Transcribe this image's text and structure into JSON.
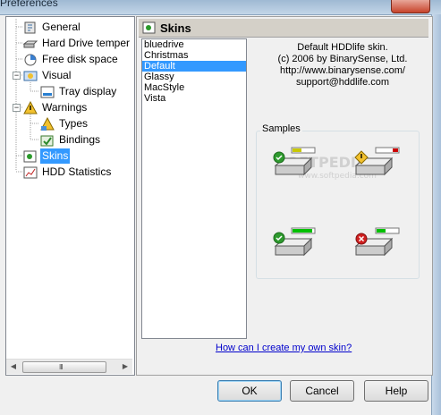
{
  "window": {
    "title": "Preferences"
  },
  "tree": {
    "items": [
      {
        "label": "General",
        "icon": "general-settings-icon",
        "selected": false
      },
      {
        "label": "Hard Drive temper",
        "icon": "hard-drive-icon",
        "selected": false
      },
      {
        "label": "Free disk space",
        "icon": "disk-space-icon",
        "selected": false
      },
      {
        "label": "Visual",
        "icon": "visual-icon",
        "selected": false
      },
      {
        "label": "Tray display",
        "icon": "tray-display-icon",
        "selected": false
      },
      {
        "label": "Warnings",
        "icon": "warnings-icon",
        "selected": false
      },
      {
        "label": "Types",
        "icon": "types-icon",
        "selected": false
      },
      {
        "label": "Bindings",
        "icon": "bindings-icon",
        "selected": false
      },
      {
        "label": "Skins",
        "icon": "skins-icon",
        "selected": true
      },
      {
        "label": "HDD Statistics",
        "icon": "hdd-statistics-icon",
        "selected": false
      }
    ],
    "expanders": [
      "−",
      "−"
    ],
    "scrollbar": {
      "left_arrow": "◀",
      "right_arrow": "▶",
      "grip": "III"
    }
  },
  "panel": {
    "title": "Skins",
    "skins": [
      "bluedrive",
      "Christmas",
      "Default",
      "Glassy",
      "MacStyle",
      "Vista"
    ],
    "selected_skin": "Default",
    "about_lines": [
      "Default HDDlife skin.",
      "(c) 2006 by BinarySense, Ltd.",
      "http://www.binarysense.com/",
      "support@hddlife.com"
    ],
    "samples_label": "Samples",
    "samples": [
      {
        "status": "ok",
        "bar_color": "#c8c800",
        "level": 0.45
      },
      {
        "status": "warning",
        "bar_color": "#cc0000",
        "level": 0.15
      },
      {
        "status": "ok",
        "bar_color": "#00c000",
        "level": 0.9
      },
      {
        "status": "error",
        "bar_color": "#00c000",
        "level": 0.45
      }
    ],
    "link": "How can I create my own skin?",
    "watermark": "SOFTPEDIA",
    "watermark_url": "www.softpedia.com"
  },
  "buttons": {
    "ok": "OK",
    "cancel": "Cancel",
    "help": "Help"
  },
  "colors": {
    "selection": "#3399ff",
    "link": "#0000cc"
  }
}
